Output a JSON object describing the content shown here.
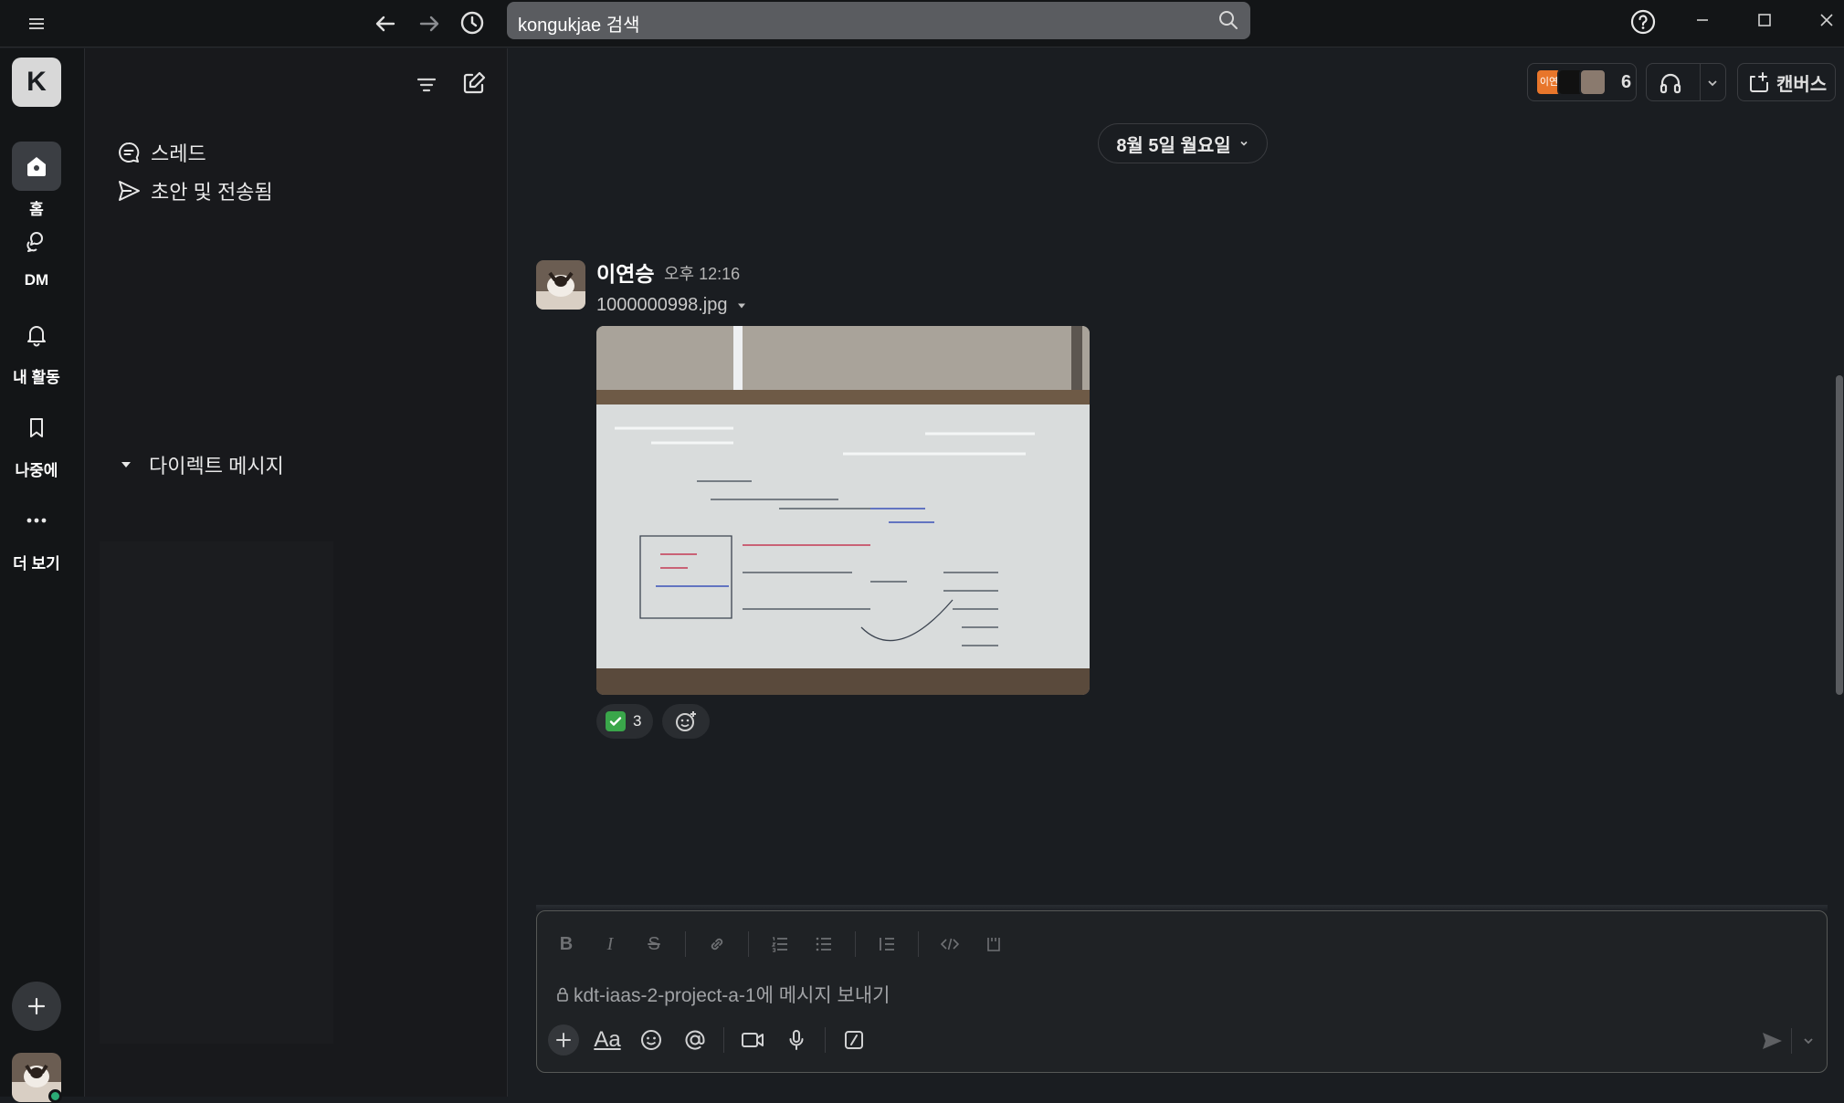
{
  "window": {
    "search_placeholder": "kongukjae 검색"
  },
  "rail": {
    "workspace_initial": "K",
    "items": [
      {
        "label": "홈",
        "icon": "home-icon"
      },
      {
        "label": "DM",
        "icon": "dm-icon"
      },
      {
        "label": "내 활동",
        "icon": "bell-icon"
      },
      {
        "label": "나중에",
        "icon": "bookmark-icon"
      },
      {
        "label": "더 보기",
        "icon": "more-icon"
      }
    ]
  },
  "sidebar": {
    "threads_label": "스레드",
    "drafts_label": "초안 및 전송됨",
    "dm_section_label": "다이렉트 메시지"
  },
  "header": {
    "member_avatar_text": "이연",
    "member_count": "6",
    "canvas_label": "캔버스"
  },
  "date_divider": "8월 5일 월요일",
  "message": {
    "author": "이연승",
    "time": "오후 12:16",
    "file_name": "1000000998.jpg",
    "reaction_emoji": "✅",
    "reaction_count": "3"
  },
  "composer": {
    "placeholder": "kdt-iaas-2-project-a-1에 메시지 보내기",
    "aa_label": "Aa"
  },
  "colors": {
    "background": "#1a1d21",
    "rail": "#131517",
    "search": "#5a5c60",
    "presence": "#2bac76",
    "reaction_check": "#3aa64a"
  }
}
